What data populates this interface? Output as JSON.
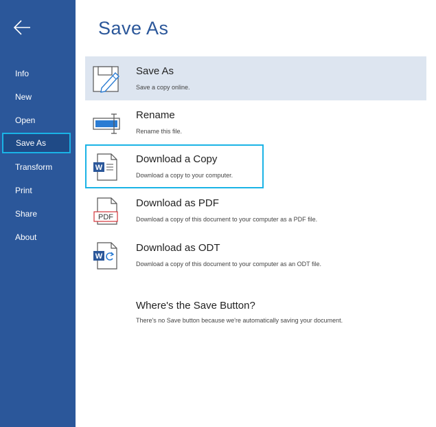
{
  "page_title": "Save As",
  "sidebar": {
    "items": [
      {
        "label": "Info"
      },
      {
        "label": "New"
      },
      {
        "label": "Open"
      },
      {
        "label": "Save As",
        "active": true
      },
      {
        "label": "Transform"
      },
      {
        "label": "Print"
      },
      {
        "label": "Share"
      },
      {
        "label": "About"
      }
    ]
  },
  "options": [
    {
      "label": "Save As",
      "desc": "Save a copy online.",
      "icon": "save-as-icon",
      "state": "selected"
    },
    {
      "label": "Rename",
      "desc": "Rename this file.",
      "icon": "rename-icon"
    },
    {
      "label": "Download a Copy",
      "desc": "Download a copy to your computer.",
      "icon": "word-document-icon",
      "state": "focused"
    },
    {
      "label": "Download as PDF",
      "desc": "Download a copy of this document to your computer as a PDF file.",
      "icon": "pdf-document-icon",
      "icon_text": "PDF"
    },
    {
      "label": "Download as ODT",
      "desc": "Download a copy of this document to your computer as an ODT file.",
      "icon": "odt-document-icon"
    }
  ],
  "help": {
    "title": "Where's the Save Button?",
    "text": "There's no Save button because we're automatically saving your document."
  },
  "colors": {
    "sidebar_bg": "#2b579a",
    "accent": "#2b579a",
    "focus_border": "#1ab3e6",
    "selected_bg": "#dde5f0"
  }
}
